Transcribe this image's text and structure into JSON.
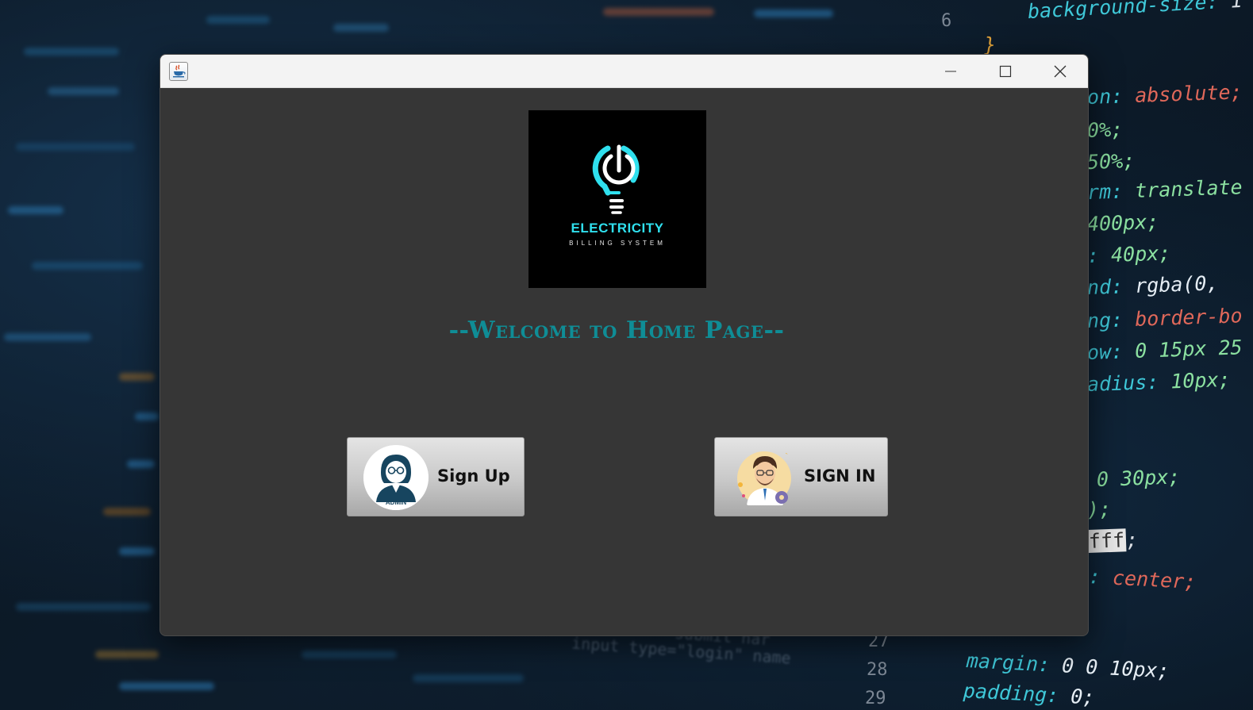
{
  "wallpaper": {
    "code_lines": [
      {
        "prop": "background-size:",
        "value": " 1"
      },
      {
        "prop": "}",
        "value": ""
      },
      {
        "prop": "on:",
        "value": " absolute;"
      },
      {
        "prop": "0%;",
        "value": ""
      },
      {
        "prop": "50%;",
        "value": ""
      },
      {
        "prop": "rm:",
        "value": " translate"
      },
      {
        "prop": "400px;",
        "value": ""
      },
      {
        "prop": ":",
        "value": " 40px;"
      },
      {
        "prop": "nd:",
        "value": " rgba(0,"
      },
      {
        "prop": "ng:",
        "value": " border-bo"
      },
      {
        "prop": "ow:",
        "value": " 0 15px 25"
      },
      {
        "prop": "adius:",
        "value": " 10px;"
      },
      {
        "prop": "0 30px;",
        "value": ""
      },
      {
        "prop": ");",
        "value": ""
      },
      {
        "prop": "fff",
        "value": ";"
      },
      {
        "prop": ":",
        "value": " center;"
      },
      {
        "prop": "margin:",
        "value": " 0 0 10px;"
      },
      {
        "prop": "padding:",
        "value": " 0;"
      }
    ],
    "line_numbers": [
      "6",
      "27",
      "28",
      "29"
    ],
    "dim_code": [
      "input type=\"login\" name",
      "submit nar"
    ]
  },
  "window": {
    "title": "",
    "controls": {
      "minimize": "minimize",
      "maximize": "maximize",
      "close": "close"
    }
  },
  "logo": {
    "title": "ELECTRICITY",
    "subtitle": "BILLING SYSTEM",
    "accent_color": "#2fe0ee"
  },
  "welcome": {
    "heading": "--Welcome to Home Page--",
    "color": "#0f8d96"
  },
  "buttons": {
    "sign_up": {
      "label": "Sign Up",
      "avatar_text": "ADMIN"
    },
    "sign_in": {
      "label": "SIGN IN"
    }
  }
}
